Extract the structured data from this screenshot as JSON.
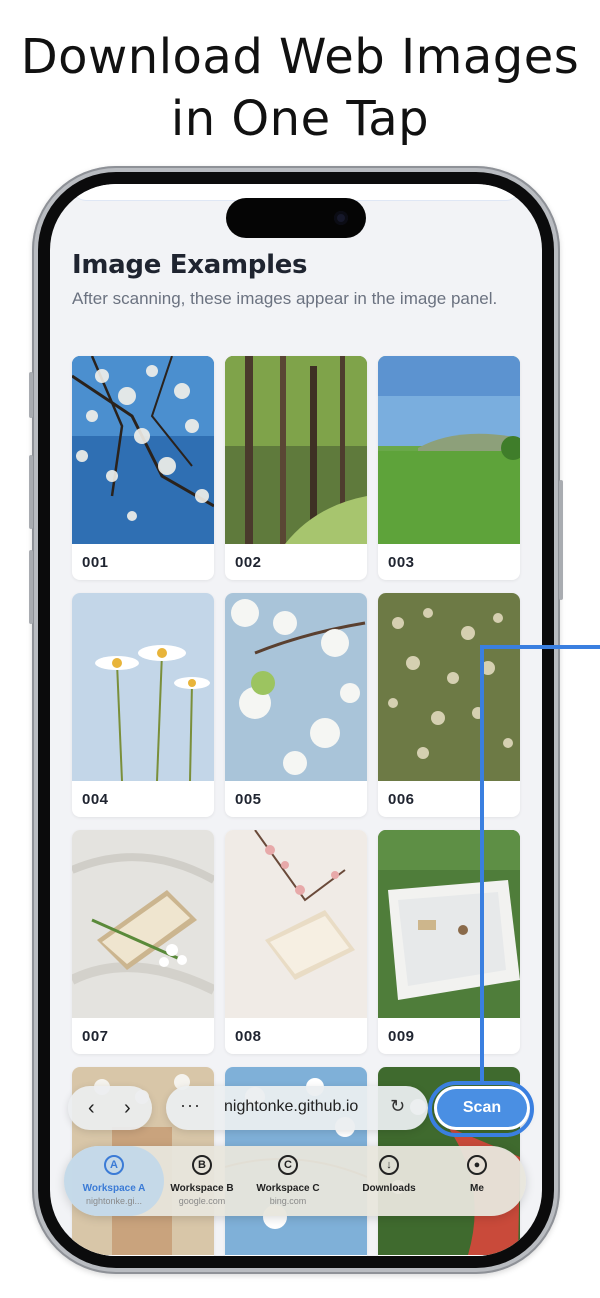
{
  "headline": [
    "Download Web Images",
    "in One Tap"
  ],
  "section": {
    "title": "Image Examples",
    "description": "After scanning, these images appear in the image panel."
  },
  "tiles": [
    {
      "label": "001"
    },
    {
      "label": "002"
    },
    {
      "label": "003"
    },
    {
      "label": "004"
    },
    {
      "label": "005"
    },
    {
      "label": "006"
    },
    {
      "label": "007"
    },
    {
      "label": "008"
    },
    {
      "label": "009"
    }
  ],
  "browser": {
    "back": "‹",
    "forward": "›",
    "menu": "···",
    "url": "nightonke.github.io",
    "reload": "↻",
    "scan_label": "Scan"
  },
  "tabbar": [
    {
      "letter": "A",
      "label": "Workspace A",
      "sub": "nightonke.gi...",
      "active": true
    },
    {
      "letter": "B",
      "label": "Workspace B",
      "sub": "google.com",
      "active": false
    },
    {
      "letter": "C",
      "label": "Workspace C",
      "sub": "bing.com",
      "active": false
    },
    {
      "letter": "↓",
      "label": "Downloads",
      "sub": "",
      "active": false
    },
    {
      "letter": "●",
      "label": "Me",
      "sub": "",
      "active": false
    }
  ],
  "colors": {
    "accent": "#3a7fe0",
    "scan_button": "#4a8fe3"
  }
}
